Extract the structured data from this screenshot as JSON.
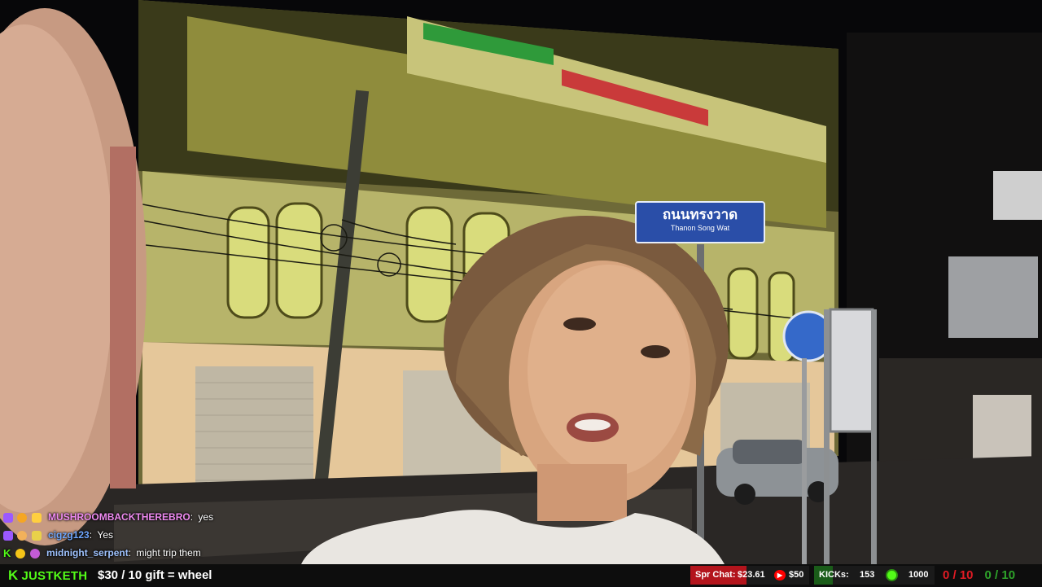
{
  "street_sign": {
    "thai": "ถนนทรงวาด",
    "latin": "Thanon Song Wat"
  },
  "chat": {
    "messages": [
      {
        "badges": [
          "sub-badge",
          "gift-badge",
          "crown-badge"
        ],
        "username": "MUSHROOMBACKTHEREBRO",
        "user_color": "#f08bf2",
        "separator": ":",
        "text": "yes"
      },
      {
        "badges": [
          "sub-badge",
          "emoji-badge",
          "butterfly-badge"
        ],
        "username": "cigzg123",
        "user_color": "#6fa8ff",
        "separator": ":",
        "text": "Yes"
      },
      {
        "badges": [
          "kick-badge",
          "coin-badge",
          "heart-badge"
        ],
        "username": "midnight_serpent",
        "user_color": "#9fc3ff",
        "separator": ":",
        "text": "might trip them"
      }
    ]
  },
  "bar": {
    "brand_icon": "K",
    "brand_name": "JUSTKETH",
    "goal_text": "$30 / 10 gift = wheel",
    "spr": {
      "label": "Spr Chat:",
      "amount": "$23.61",
      "goal": "$50",
      "progress": 0.47,
      "fill_color": "#b3141c",
      "icon": "youtube-icon"
    },
    "kicks": {
      "label": "KICKs:",
      "count": "153",
      "goal": "1000",
      "progress": 0.153,
      "fill_color": "#1a5c19",
      "icon": "globe-icon"
    },
    "score_red": "0 / 10",
    "score_green": "0 / 10"
  },
  "colors": {
    "kick_green": "#53fc18",
    "alert_red": "#e01b24",
    "success_green": "#2ea32a"
  }
}
